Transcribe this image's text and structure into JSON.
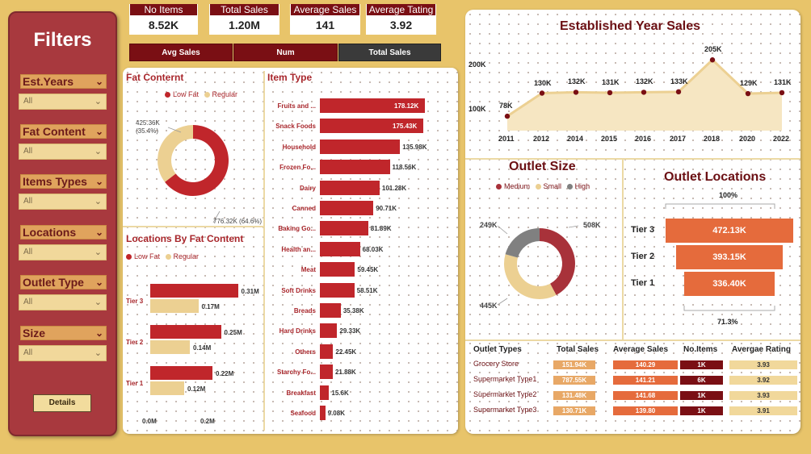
{
  "filters": {
    "title": "Filters",
    "items": [
      {
        "label": "Est.Years",
        "value": "All"
      },
      {
        "label": "Fat Content",
        "value": "All"
      },
      {
        "label": "Items Types",
        "value": "All"
      },
      {
        "label": "Locations",
        "value": "All"
      },
      {
        "label": "Outlet Type",
        "value": "All"
      },
      {
        "label": "Size",
        "value": "All"
      }
    ],
    "details_label": "Details"
  },
  "kpis": [
    {
      "label": "No Items",
      "value": "8.52K"
    },
    {
      "label": "Total Sales",
      "value": "1.20M"
    },
    {
      "label": "Average Sales",
      "value": "141"
    },
    {
      "label": "Average Tating",
      "value": "3.92"
    }
  ],
  "measure_buttons": [
    "Avg Sales",
    "Num",
    "Total Sales"
  ],
  "colors": {
    "dark_red": "#7a0f14",
    "red": "#c0262b",
    "maroon": "#a8323a",
    "beige": "#ecd092",
    "grey": "#808080",
    "orange": "#e56b3c",
    "gold": "#e8c46a"
  },
  "fat_content": {
    "title": "Fat Conternt",
    "legend": [
      "Low Fat",
      "Regular"
    ],
    "regular_label": "425.36K\n(35.4%)",
    "regular_label_l1": "425.36K",
    "regular_label_l2": "(35.4%)",
    "lowfat_label": "776.32K (64.6%)"
  },
  "locations_fat": {
    "title": "Locations By Fat Content",
    "legend": [
      "Low Fat",
      "Regular"
    ],
    "axis": [
      "0.0M",
      "0.2M"
    ],
    "rows": [
      {
        "tier": "Tier 3",
        "low_fat": "0.31M",
        "regular": "0.17M"
      },
      {
        "tier": "Tier 2",
        "low_fat": "0.25M",
        "regular": "0.14M"
      },
      {
        "tier": "Tier 1",
        "low_fat": "0.22M",
        "regular": "0.12M"
      }
    ]
  },
  "item_type": {
    "title": "Item Type",
    "rows": [
      {
        "name": "Fruits and ...",
        "value": "178.12K"
      },
      {
        "name": "Snack Foods",
        "value": "175.43K"
      },
      {
        "name": "Household",
        "value": "135.98K"
      },
      {
        "name": "Frozen Fo...",
        "value": "118.56K"
      },
      {
        "name": "Dairy",
        "value": "101.28K"
      },
      {
        "name": "Canned",
        "value": "90.71K"
      },
      {
        "name": "Baking Go...",
        "value": "81.89K"
      },
      {
        "name": "Health an...",
        "value": "68.03K"
      },
      {
        "name": "Meat",
        "value": "59.45K"
      },
      {
        "name": "Soft Drinks",
        "value": "58.51K"
      },
      {
        "name": "Breads",
        "value": "35.38K"
      },
      {
        "name": "Hard Drinks",
        "value": "29.33K"
      },
      {
        "name": "Others",
        "value": "22.45K"
      },
      {
        "name": "Starchy Fo...",
        "value": "21.88K"
      },
      {
        "name": "Breakfast",
        "value": "15.6K"
      },
      {
        "name": "Seafood",
        "value": "9.08K"
      }
    ]
  },
  "established": {
    "title": "Established Year Sales",
    "y_ticks": [
      "200K",
      "100K"
    ],
    "points": [
      {
        "year": "2011",
        "label": "78K"
      },
      {
        "year": "2012",
        "label": "130K"
      },
      {
        "year": "2014",
        "label": "132K"
      },
      {
        "year": "2015",
        "label": "131K"
      },
      {
        "year": "2016",
        "label": "132K"
      },
      {
        "year": "2017",
        "label": "133K"
      },
      {
        "year": "2018",
        "label": "205K"
      },
      {
        "year": "2020",
        "label": "129K"
      },
      {
        "year": "2022",
        "label": "131K"
      }
    ]
  },
  "outlet_size": {
    "title": "Outlet Size",
    "legend": [
      "Medium",
      "Small",
      "High"
    ],
    "medium_label": "508K",
    "small_label": "445K",
    "high_label": "249K"
  },
  "outlet_locations": {
    "title": "Outlet Locations",
    "top_pct": "100%",
    "bottom_pct": "71.3%",
    "rows": [
      {
        "tier": "Tier 3",
        "value": "472.13K"
      },
      {
        "tier": "Tier 2",
        "value": "393.15K"
      },
      {
        "tier": "Tier 1",
        "value": "336.40K"
      }
    ]
  },
  "outlet_table": {
    "headers": [
      "Outlet Types",
      "Total Sales",
      "Average Sales",
      "No.Items",
      "Avergae Rating"
    ],
    "rows": [
      {
        "type": "Grocery Store",
        "total": "151.94K",
        "avg": "140.29",
        "items": "1K",
        "rating": "3.93"
      },
      {
        "type": "Supermarket Type1",
        "total": "787.55K",
        "avg": "141.21",
        "items": "6K",
        "rating": "3.92"
      },
      {
        "type": "Supermarket Type2",
        "total": "131.48K",
        "avg": "141.68",
        "items": "1K",
        "rating": "3.93"
      },
      {
        "type": "Supermarket Type3",
        "total": "130.71K",
        "avg": "139.80",
        "items": "1K",
        "rating": "3.91"
      }
    ]
  },
  "chart_data": [
    {
      "type": "pie",
      "title": "Fat Conternt",
      "categories": [
        "Low Fat",
        "Regular"
      ],
      "values": [
        776.32,
        425.36
      ],
      "unit": "K",
      "percent": [
        64.6,
        35.4
      ]
    },
    {
      "type": "bar",
      "title": "Item Type",
      "categories": [
        "Fruits and ...",
        "Snack Foods",
        "Household",
        "Frozen Fo...",
        "Dairy",
        "Canned",
        "Baking Go...",
        "Health an...",
        "Meat",
        "Soft Drinks",
        "Breads",
        "Hard Drinks",
        "Others",
        "Starchy Fo...",
        "Breakfast",
        "Seafood"
      ],
      "values": [
        178.12,
        175.43,
        135.98,
        118.56,
        101.28,
        90.71,
        81.89,
        68.03,
        59.45,
        58.51,
        35.38,
        29.33,
        22.45,
        21.88,
        15.6,
        9.08
      ],
      "unit": "K"
    },
    {
      "type": "bar",
      "title": "Locations By Fat Content",
      "categories": [
        "Tier 3",
        "Tier 2",
        "Tier 1"
      ],
      "series": [
        {
          "name": "Low Fat",
          "values": [
            0.31,
            0.25,
            0.22
          ]
        },
        {
          "name": "Regular",
          "values": [
            0.17,
            0.14,
            0.12
          ]
        }
      ],
      "unit": "M"
    },
    {
      "type": "area",
      "title": "Established Year Sales",
      "x": [
        "2011",
        "2012",
        "2014",
        "2015",
        "2016",
        "2017",
        "2018",
        "2020",
        "2022"
      ],
      "values": [
        78,
        130,
        132,
        131,
        132,
        133,
        205,
        129,
        131
      ],
      "unit": "K"
    },
    {
      "type": "pie",
      "title": "Outlet Size",
      "categories": [
        "Medium",
        "Small",
        "High"
      ],
      "values": [
        508,
        445,
        249
      ],
      "unit": "K"
    },
    {
      "type": "bar",
      "title": "Outlet Locations",
      "categories": [
        "Tier 3",
        "Tier 2",
        "Tier 1"
      ],
      "values": [
        472.13,
        393.15,
        336.4
      ],
      "unit": "K"
    }
  ]
}
